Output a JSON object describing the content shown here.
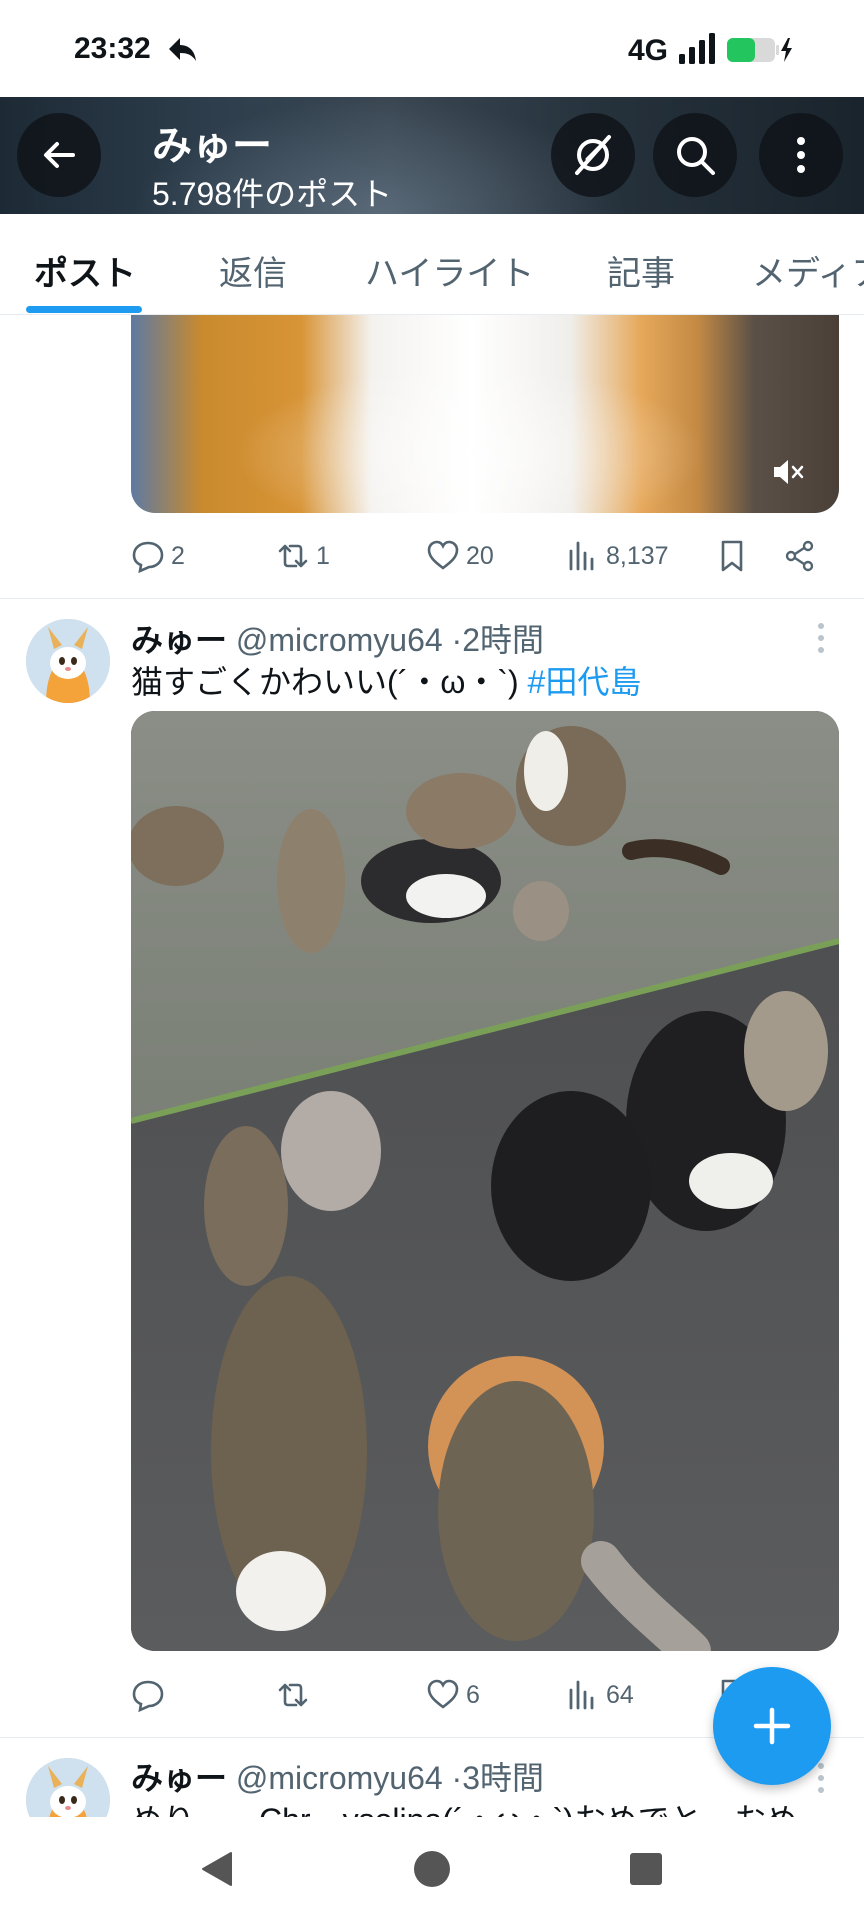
{
  "status_bar": {
    "time": "23:32",
    "network": "4G"
  },
  "header": {
    "name": "みゅー",
    "post_count": "5.798件のポスト"
  },
  "tabs": [
    {
      "label": "ポスト",
      "active": true
    },
    {
      "label": "返信",
      "active": false
    },
    {
      "label": "ハイライト",
      "active": false
    },
    {
      "label": "記事",
      "active": false
    },
    {
      "label": "メディア",
      "active": false
    }
  ],
  "posts": [
    {
      "media": "video",
      "actions": {
        "replies": "2",
        "reposts": "1",
        "likes": "20",
        "views": "8,137"
      }
    },
    {
      "author": "みゅー",
      "handle": "@micromyu64",
      "time": "2時間",
      "text": "猫すごくかわいい(´・ω・`)",
      "hashtag": "#田代島",
      "media": "photo",
      "actions": {
        "replies": "",
        "reposts": "",
        "likes": "6",
        "views": "64"
      }
    },
    {
      "author": "みゅー",
      "handle": "@micromyu64",
      "time": "3時間",
      "text": "めりー…Chr…ysolina(´・ω・`)おめでと…おめ"
    }
  ],
  "colors": {
    "accent": "#1d9bf0",
    "text_primary": "#0f1419",
    "text_secondary": "#536471",
    "battery": "#22c55e"
  }
}
